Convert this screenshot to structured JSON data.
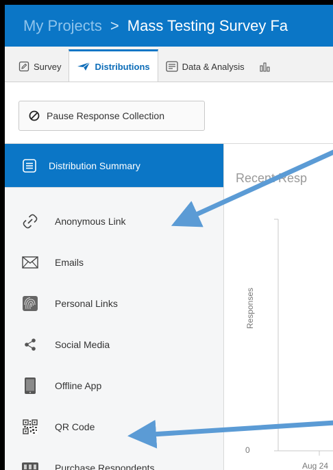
{
  "header": {
    "breadcrumb_root": "My Projects",
    "separator": ">",
    "project_title": "Mass Testing Survey Fa"
  },
  "tabs": [
    {
      "label": "Survey",
      "icon": "pencil-icon",
      "active": false
    },
    {
      "label": "Distributions",
      "icon": "paper-plane-icon",
      "active": true
    },
    {
      "label": "Data & Analysis",
      "icon": "document-list-icon",
      "active": false
    }
  ],
  "toolbar": {
    "pause_label": "Pause Response Collection",
    "pause_icon": "prohibit-icon"
  },
  "sidebar": {
    "summary_label": "Distribution Summary",
    "items": [
      {
        "label": "Anonymous Link",
        "icon": "link-icon"
      },
      {
        "label": "Emails",
        "icon": "envelope-icon"
      },
      {
        "label": "Personal Links",
        "icon": "fingerprint-icon"
      },
      {
        "label": "Social Media",
        "icon": "share-icon"
      },
      {
        "label": "Offline App",
        "icon": "tablet-icon"
      },
      {
        "label": "QR Code",
        "icon": "qr-code-icon"
      },
      {
        "label": "Purchase Respondents",
        "icon": "panel-icon"
      }
    ]
  },
  "main": {
    "chart_title": "Recent Resp",
    "ylabel": "Responses",
    "ytick": "0",
    "xtick": "Aug 24"
  },
  "colors": {
    "accent": "#0b76c6",
    "arrow": "#5b9bd5"
  }
}
